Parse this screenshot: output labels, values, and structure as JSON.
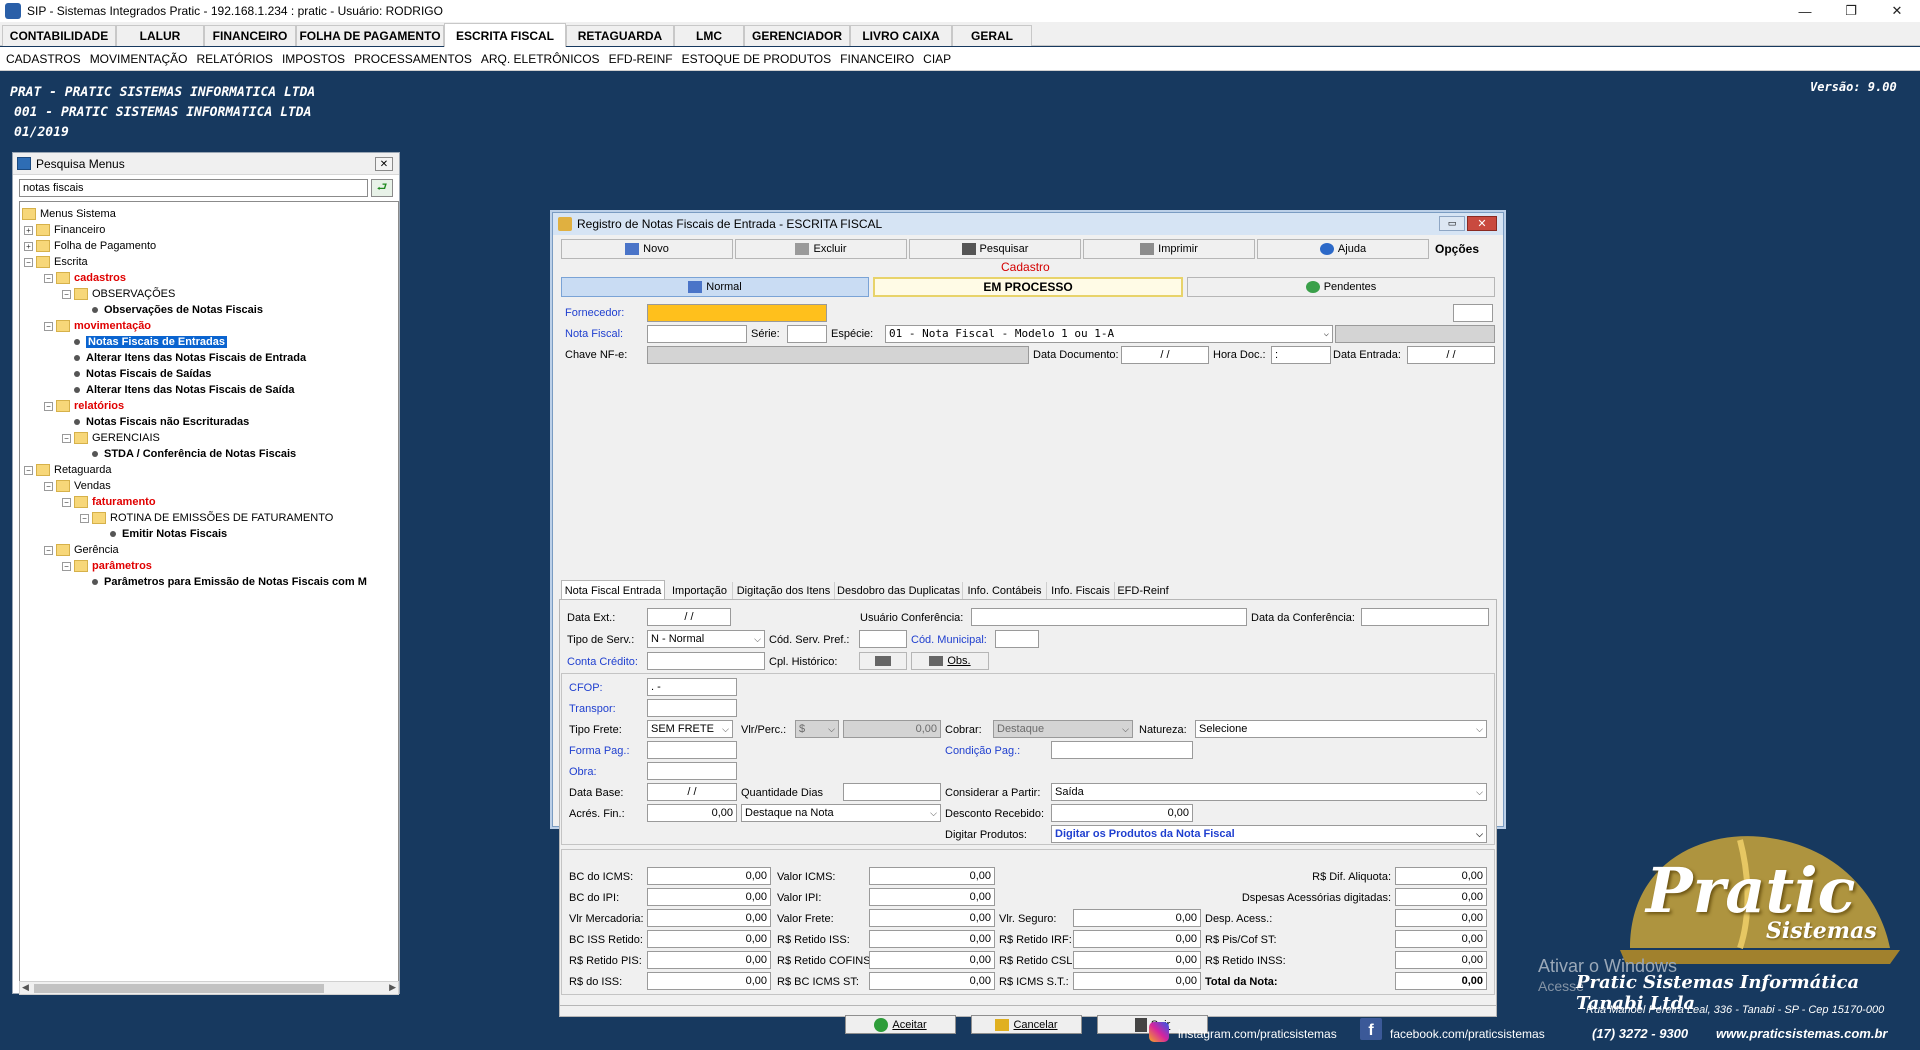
{
  "window": {
    "title": "SIP - Sistemas Integrados Pratic - 192.168.1.234 : pratic - Usuário: RODRIGO",
    "min": "—",
    "max": "❐",
    "close": "✕"
  },
  "main_tabs": [
    "CONTABILIDADE",
    "LALUR",
    "FINANCEIRO",
    "FOLHA DE PAGAMENTO",
    "ESCRITA FISCAL",
    "RETAGUARDA",
    "LMC",
    "GERENCIADOR",
    "LIVRO CAIXA",
    "GERAL"
  ],
  "submenu": [
    "CADASTROS",
    "MOVIMENTAÇÃO",
    "RELATÓRIOS",
    "IMPOSTOS",
    "PROCESSAMENTOS",
    "ARQ. ELETRÔNICOS",
    "EFD-REINF",
    "ESTOQUE DE PRODUTOS",
    "FINANCEIRO",
    "CIAP"
  ],
  "header": {
    "line1": "PRAT - PRATIC SISTEMAS INFORMATICA LTDA",
    "line2": "001 - PRATIC SISTEMAS INFORMATICA LTDA",
    "line3": "01/2019",
    "version": "Versão: 9.00"
  },
  "menu_panel": {
    "title": "Pesquisa Menus",
    "search_value": "notas fiscais",
    "close": "✕",
    "go": "⮐",
    "tree": [
      {
        "label": "Menus Sistema",
        "style": "plain"
      },
      {
        "label": "Financeiro",
        "style": "plain"
      },
      {
        "label": "Folha de Pagamento",
        "style": "plain"
      },
      {
        "label": "Escrita",
        "style": "plain"
      },
      {
        "label": "cadastros",
        "style": "red"
      },
      {
        "label": "OBSERVAÇÕES",
        "style": "plain"
      },
      {
        "label": "Observações de Notas Fiscais",
        "style": "bold"
      },
      {
        "label": "movimentação",
        "style": "red"
      },
      {
        "label": "Notas Fiscais de Entradas",
        "style": "selected"
      },
      {
        "label": "Alterar Itens das Notas Fiscais de Entrada",
        "style": "bold"
      },
      {
        "label": "Notas Fiscais de Saídas",
        "style": "bold"
      },
      {
        "label": "Alterar Itens das Notas Fiscais de Saída",
        "style": "bold"
      },
      {
        "label": "relatórios",
        "style": "red"
      },
      {
        "label": "Notas Fiscais não Escrituradas",
        "style": "bold"
      },
      {
        "label": "GERENCIAIS",
        "style": "plain"
      },
      {
        "label": "STDA / Conferência de Notas Fiscais",
        "style": "bold"
      },
      {
        "label": "Retaguarda",
        "style": "plain"
      },
      {
        "label": "Vendas",
        "style": "plain"
      },
      {
        "label": "faturamento",
        "style": "red"
      },
      {
        "label": "ROTINA DE EMISSÕES DE FATURAMENTO",
        "style": "plain"
      },
      {
        "label": "Emitir Notas Fiscais",
        "style": "bold"
      },
      {
        "label": "Gerência",
        "style": "plain"
      },
      {
        "label": "parâmetros",
        "style": "red"
      },
      {
        "label": "Parâmetros para Emissão de Notas Fiscais com M",
        "style": "bold"
      }
    ]
  },
  "dialog": {
    "title": "Registro de Notas Fiscais de Entrada - ESCRITA FISCAL",
    "toolbar": {
      "novo": "Novo",
      "excluir": "Excluir",
      "pesquisar": "Pesquisar",
      "imprimir": "Imprimir",
      "ajuda": "Ajuda",
      "opcoes": "Opções"
    },
    "mode": "Cadastro",
    "status_tabs": {
      "normal": "Normal",
      "em_processo": "EM PROCESSO",
      "pendentes": "Pendentes"
    },
    "labels": {
      "fornecedor": "Fornecedor:",
      "nota_fiscal": "Nota Fiscal:",
      "serie": "Série:",
      "especie": "Espécie:",
      "chave_nfe": "Chave NF-e:",
      "data_documento": "Data Documento:",
      "hora_doc": "Hora Doc.:",
      "data_entrada": "Data Entrada:",
      "data_ext": "Data Ext.:",
      "usuario_conferencia": "Usuário Conferência:",
      "data_conferencia": "Data da Conferência:",
      "tipo_serv": "Tipo de Serv.:",
      "cod_serv_pref": "Cód. Serv. Pref.:",
      "cod_municipal": "Cód. Municipal:",
      "conta_credito": "Conta Crédito:",
      "cpl_historico": "Cpl. Histórico:",
      "cfop": "CFOP:",
      "transpor": "Transpor:",
      "tipo_frete": "Tipo Frete:",
      "vlr_perc": "Vlr/Perc.:",
      "cobrar": "Cobrar:",
      "natureza": "Natureza:",
      "forma_pag": "Forma Pag.:",
      "condicao_pag": "Condição Pag.:",
      "obra": "Obra:",
      "data_base": "Data Base:",
      "quantidade_dias": "Quantidade Dias",
      "considerar_a_partir": "Considerar a Partir:",
      "acres_fin": "Acrés. Fin.:",
      "desconto_recebido": "Desconto Recebido:",
      "digitar_produtos": "Digitar Produtos:",
      "bc_icms": "BC do ICMS:",
      "valor_icms": "Valor ICMS:",
      "dif_aliquota": "R$ Dif. Aliquota:",
      "bc_ipi": "BC do IPI:",
      "valor_ipi": "Valor IPI:",
      "despesas_acessorias": "Dspesas Acessórias digitadas:",
      "vlr_mercadoria": "Vlr Mercadoria:",
      "valor_frete": "Valor Frete:",
      "vlr_seguro": "Vlr. Seguro:",
      "desp_acess": "Desp. Acess.:",
      "bc_iss_retido": "BC ISS Retido:",
      "retido_iss": "R$ Retido ISS:",
      "retido_irf": "R$ Retido IRF:",
      "pis_cof_st": "R$ Pis/Cof ST:",
      "retido_pis": "R$ Retido PIS:",
      "retido_cofins": "R$ Retido COFINS:",
      "retido_csl": "R$ Retido CSL:",
      "retido_inss": "R$ Retido INSS:",
      "rs_iss": "R$ do ISS:",
      "rs_bc_icms_st": "R$ BC ICMS ST:",
      "rs_icms_st": "R$ ICMS S.T.:",
      "total_nota": "Total da Nota:"
    },
    "values": {
      "especie": "01  - Nota Fiscal - Modelo 1 ou 1-A",
      "data_documento": "/ /",
      "hora_doc": ":",
      "data_entrada": "/ /",
      "data_ext": "/ /",
      "tipo_serv": "N - Normal",
      "cfop": ".  -",
      "tipo_frete": "SEM FRETE",
      "vlr_perc_sel": "$",
      "vlr_perc_val": "0,00",
      "cobrar": "Destaque",
      "natureza": "Selecione",
      "data_base": "/ /",
      "considerar_a_partir": "Saída",
      "acres_fin": "0,00",
      "acres_fin_tipo": "Destaque na Nota",
      "desconto_recebido": "0,00",
      "digitar_produtos": "Digitar os Produtos da Nota Fiscal",
      "zero": "0,00",
      "obs": "Obs."
    },
    "sub_tabs": [
      "Nota Fiscal Entrada",
      "Importação",
      "Digitação dos Itens",
      "Desdobro das Duplicatas",
      "Info. Contábeis",
      "Info. Fiscais",
      "EFD-Reinf"
    ],
    "buttons": {
      "aceitar": "Aceitar",
      "cancelar": "Cancelar",
      "sair": "Sair"
    }
  },
  "branding": {
    "logo_text": "Pratic",
    "logo_sub": "Sistemas",
    "activate_windows": "Ativar o Windows",
    "activate_sub": "Acesse",
    "company": "Pratic Sistemas Informática Tanabi Ltda",
    "address": "Rua Manoel Pereira Leal, 336 - Tanabi - SP - Cep 15170-000",
    "phone": "(17) 3272 - 9300",
    "site": "www.praticsistemas.com.br",
    "instagram": "instagram.com/praticsistemas",
    "facebook": "facebook.com/praticsistemas"
  },
  "colors": {
    "desktop": "#17395f",
    "accent_yellow": "#ffc01c",
    "selection": "#0a64d0",
    "tree_red": "#e00000",
    "link_blue": "#1f3fcf"
  }
}
